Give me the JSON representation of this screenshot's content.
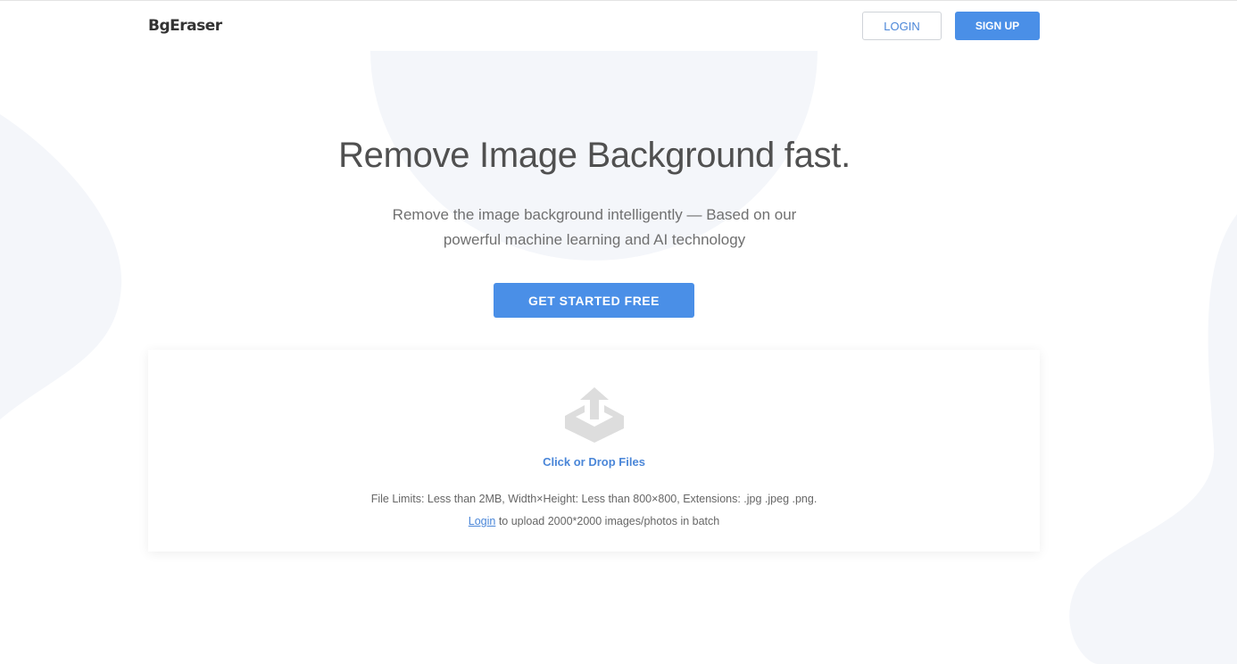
{
  "header": {
    "brand": "BgEraser",
    "login_label": "LOGIN",
    "signup_label": "SIGN UP"
  },
  "hero": {
    "title": "Remove Image Background fast.",
    "subtitle_line1": "Remove the image background intelligently — Based on our",
    "subtitle_line2": "powerful machine learning and AI technology",
    "cta_label": "GET STARTED FREE"
  },
  "upload": {
    "icon": "upload-tray-icon",
    "label": "Click or Drop Files",
    "limits": "File Limits: Less than 2MB, Width×Height: Less than 800×800, Extensions: .jpg .jpeg .png.",
    "batch_link": "Login",
    "batch_text": " to upload 2000*2000 images/photos in batch"
  },
  "colors": {
    "accent": "#4a8fe7",
    "link": "#4a86d8",
    "shape_bg": "#f4f6fa",
    "icon_gray": "#dddddd"
  }
}
